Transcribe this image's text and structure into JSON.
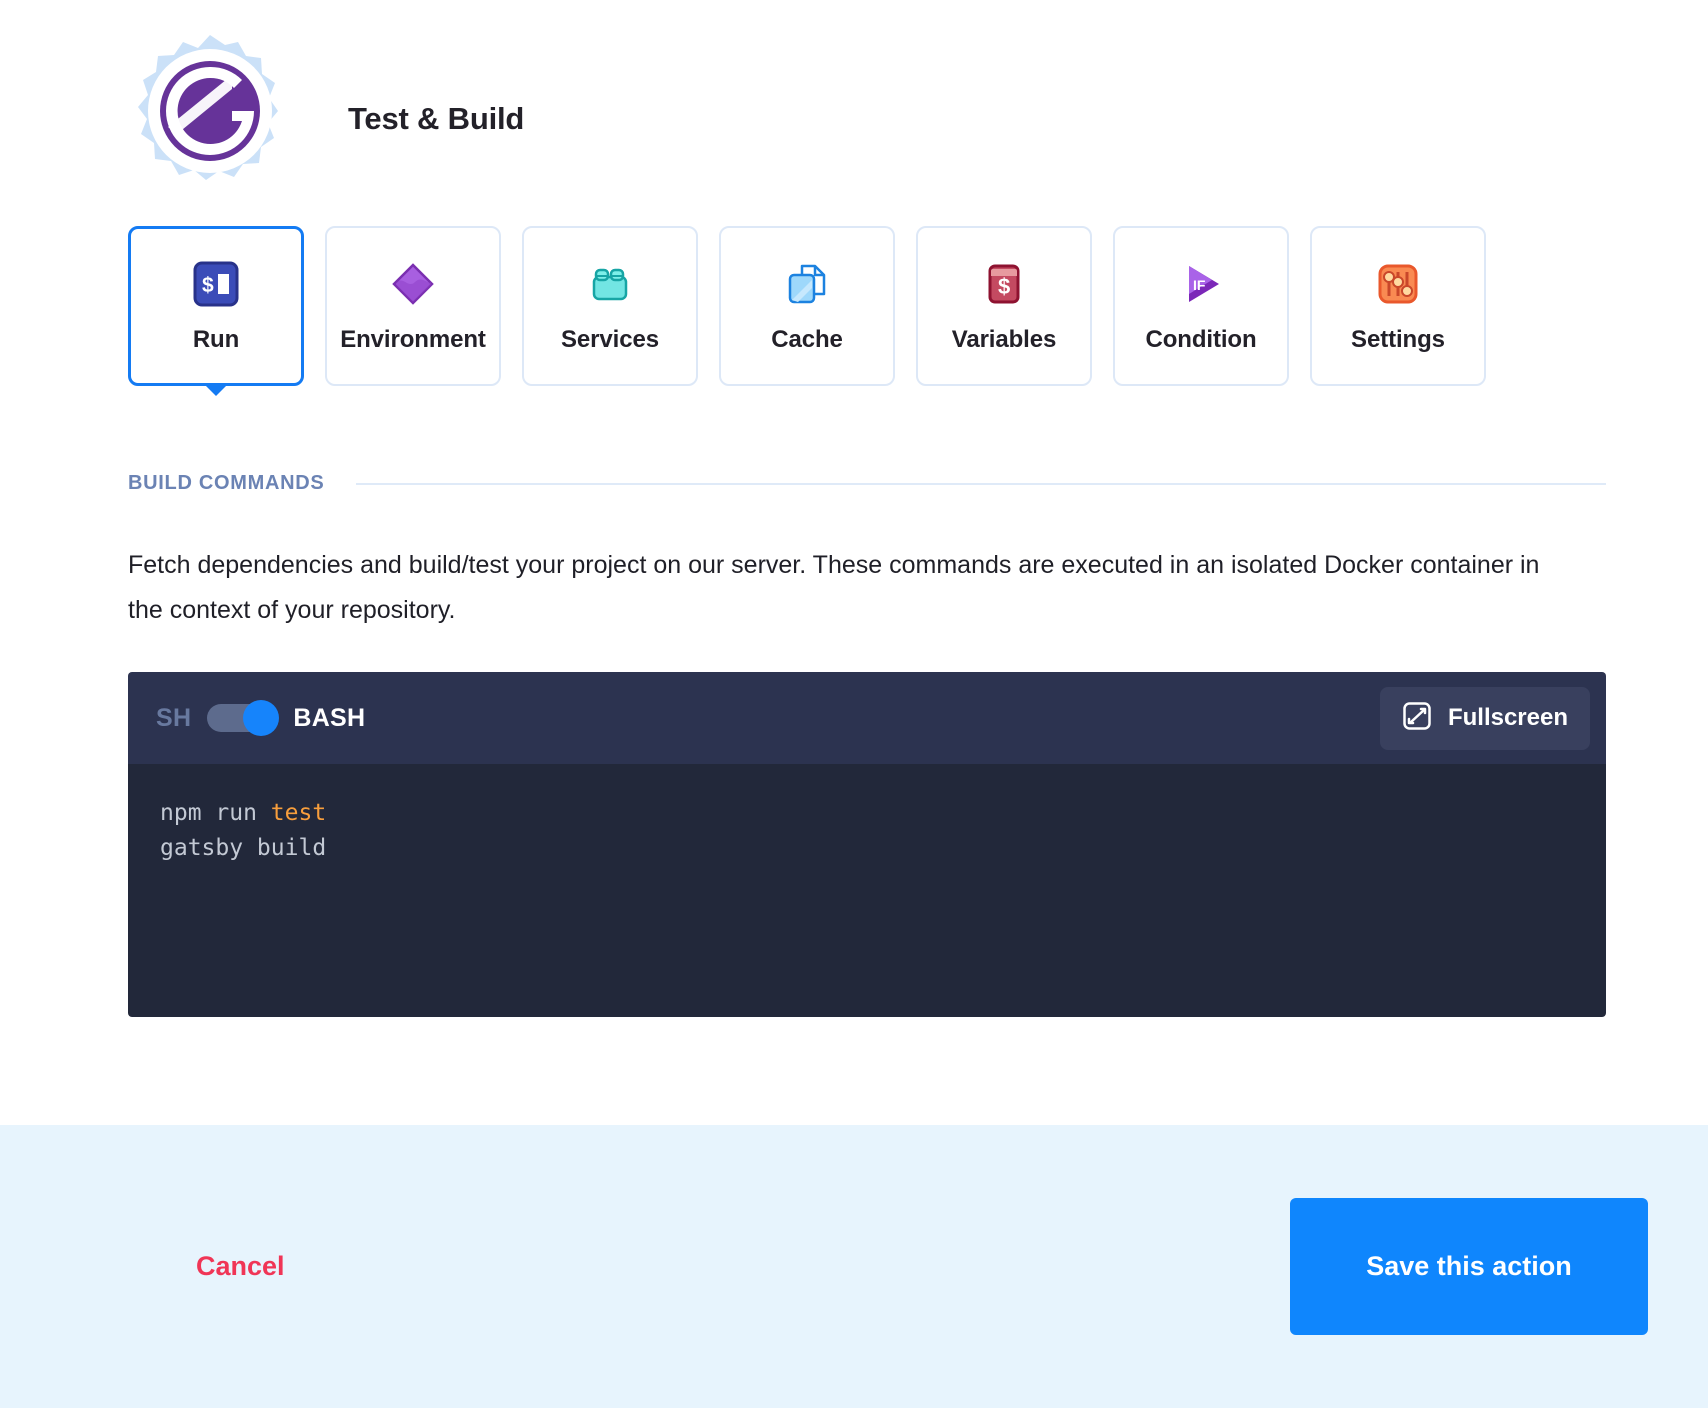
{
  "header": {
    "title": "Test & Build",
    "logo_icon": "gatsby-gear-logo",
    "gear_color": "#cbe1f8",
    "logo_color": "#663399"
  },
  "tabs": [
    {
      "label": "Run",
      "icon": "terminal-prompt-icon",
      "active": true
    },
    {
      "label": "Environment",
      "icon": "purple-diamond-icon",
      "active": false
    },
    {
      "label": "Services",
      "icon": "cyan-blocks-icon",
      "active": false
    },
    {
      "label": "Cache",
      "icon": "copy-documents-icon",
      "active": false
    },
    {
      "label": "Variables",
      "icon": "red-dollar-card-icon",
      "active": false
    },
    {
      "label": "Condition",
      "icon": "purple-if-play-icon",
      "active": false
    },
    {
      "label": "Settings",
      "icon": "orange-sliders-icon",
      "active": false
    }
  ],
  "section": {
    "title": "BUILD COMMANDS",
    "description": "Fetch dependencies and build/test your project on our server. These commands are executed in an isolated Docker container in the context of your repository."
  },
  "editor": {
    "toggle_off_label": "SH",
    "toggle_on_label": "BASH",
    "toggle_state": "on",
    "fullscreen_label": "Fullscreen",
    "fullscreen_icon": "expand-icon",
    "lines": [
      {
        "prefix": "npm run ",
        "highlight": "test",
        "suffix": ""
      },
      {
        "prefix": "gatsby build",
        "highlight": "",
        "suffix": ""
      }
    ]
  },
  "footer": {
    "cancel_label": "Cancel",
    "save_label": "Save this action",
    "save_color": "#0f86fd",
    "cancel_color": "#f03556",
    "background": "#e7f4fd"
  }
}
